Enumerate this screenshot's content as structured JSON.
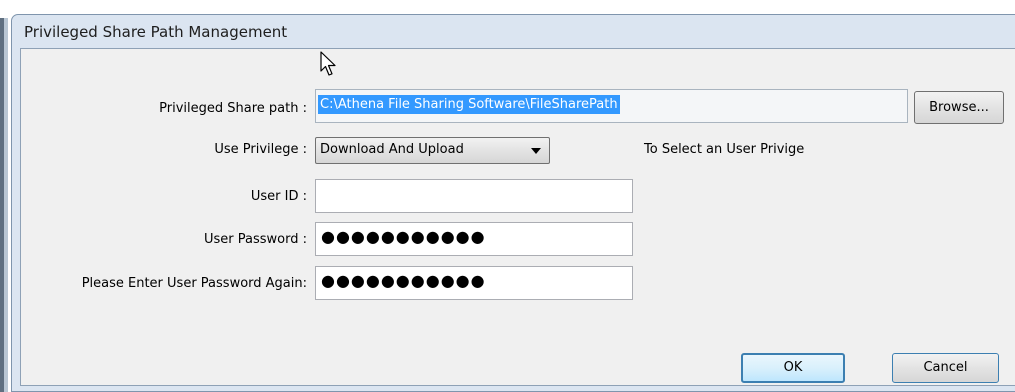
{
  "window": {
    "title": "Privileged Share Path Management"
  },
  "form": {
    "share_path_label": "Privileged Share path :",
    "share_path_value": "C:\\Athena File Sharing Software\\FileSharePath",
    "browse_label": "Browse...",
    "privilege_label": "Use Privilege :",
    "privilege_value": "Download And Upload",
    "privilege_hint": "To Select an User Privige",
    "user_id_label": "User ID :",
    "user_id_value": "",
    "password_label": "User Password :",
    "password_value": "●●●●●●●●●●●",
    "password_again_label": "Please Enter User Password Again:",
    "password_again_value": "●●●●●●●●●●●"
  },
  "buttons": {
    "ok": "OK",
    "cancel": "Cancel"
  },
  "icons": {
    "cursor": "mouse-pointer-icon"
  }
}
